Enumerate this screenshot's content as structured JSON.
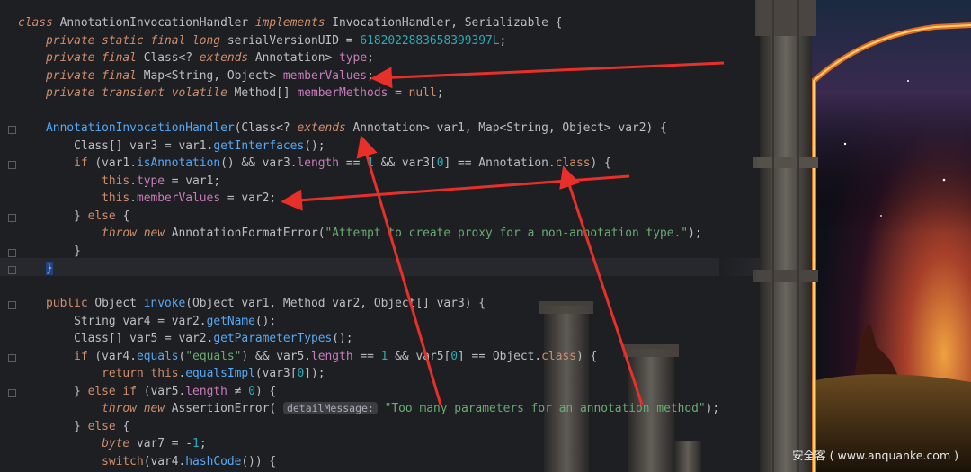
{
  "code_lines": [
    [
      [
        "kwi",
        "class "
      ],
      [
        "cls",
        "AnnotationInvocationHandler "
      ],
      [
        "kwi",
        "implements "
      ],
      [
        "cls",
        "InvocationHandler, Serializable {"
      ]
    ],
    [
      [
        "sp",
        "    "
      ],
      [
        "kwi",
        "private static final long "
      ],
      [
        "cls",
        "serialVersionUID = "
      ],
      [
        "num",
        "6182022883658399397L"
      ],
      [
        "cls",
        ";"
      ]
    ],
    [
      [
        "sp",
        "    "
      ],
      [
        "kwi",
        "private final "
      ],
      [
        "cls",
        "Class<? "
      ],
      [
        "kwi",
        "extends "
      ],
      [
        "cls",
        "Annotation> "
      ],
      [
        "fld",
        "type"
      ],
      [
        "cls",
        ";"
      ]
    ],
    [
      [
        "sp",
        "    "
      ],
      [
        "kwi",
        "private final "
      ],
      [
        "cls",
        "Map<String, Object> "
      ],
      [
        "fld",
        "memberValues"
      ],
      [
        "cls",
        ";"
      ]
    ],
    [
      [
        "sp",
        "    "
      ],
      [
        "kwi",
        "private transient volatile "
      ],
      [
        "cls",
        "Method[] "
      ],
      [
        "fld",
        "memberMethods"
      ],
      [
        "cls",
        " = "
      ],
      [
        "kw",
        "null"
      ],
      [
        "cls",
        ";"
      ]
    ],
    [],
    [
      [
        "sp",
        "    "
      ],
      [
        "fn",
        "AnnotationInvocationHandler"
      ],
      [
        "cls",
        "(Class<? "
      ],
      [
        "kwi",
        "extends "
      ],
      [
        "cls",
        "Annotation> var1, Map<String, Object> var2) {"
      ]
    ],
    [
      [
        "sp",
        "        "
      ],
      [
        "cls",
        "Class[] var3 = var1."
      ],
      [
        "fn",
        "getInterfaces"
      ],
      [
        "cls",
        "();"
      ]
    ],
    [
      [
        "sp",
        "        "
      ],
      [
        "kw",
        "if "
      ],
      [
        "cls",
        "(var1."
      ],
      [
        "fn",
        "isAnnotation"
      ],
      [
        "cls",
        "() && var3."
      ],
      [
        "fld",
        "length"
      ],
      [
        "cls",
        " == "
      ],
      [
        "num",
        "1"
      ],
      [
        "cls",
        " && var3["
      ],
      [
        "num",
        "0"
      ],
      [
        "cls",
        "] == Annotation."
      ],
      [
        "kw",
        "class"
      ],
      [
        "cls",
        ") {"
      ]
    ],
    [
      [
        "sp",
        "            "
      ],
      [
        "kw",
        "this"
      ],
      [
        "cls",
        "."
      ],
      [
        "fld",
        "type"
      ],
      [
        "cls",
        " = var1;"
      ]
    ],
    [
      [
        "sp",
        "            "
      ],
      [
        "kw",
        "this"
      ],
      [
        "cls",
        "."
      ],
      [
        "fld",
        "memberValues"
      ],
      [
        "cls",
        " = var2;"
      ]
    ],
    [
      [
        "sp",
        "        "
      ],
      [
        "cls",
        "} "
      ],
      [
        "kw",
        "else "
      ],
      [
        "cls",
        "{"
      ]
    ],
    [
      [
        "sp",
        "            "
      ],
      [
        "kwi",
        "throw new "
      ],
      [
        "cls",
        "AnnotationFormatError("
      ],
      [
        "str",
        "\"Attempt to create proxy for a non-annotation type.\""
      ],
      [
        "cls",
        ");"
      ]
    ],
    [
      [
        "sp",
        "        "
      ],
      [
        "cls",
        "}"
      ]
    ],
    [
      [
        "sp",
        "    "
      ],
      [
        "cur",
        "}"
      ]
    ],
    [],
    [
      [
        "sp",
        "    "
      ],
      [
        "kw",
        "public "
      ],
      [
        "cls",
        "Object "
      ],
      [
        "fn",
        "invoke"
      ],
      [
        "cls",
        "(Object var1, Method var2, Object[] var3) {"
      ]
    ],
    [
      [
        "sp",
        "        "
      ],
      [
        "cls",
        "String var4 = var2."
      ],
      [
        "fn",
        "getName"
      ],
      [
        "cls",
        "();"
      ]
    ],
    [
      [
        "sp",
        "        "
      ],
      [
        "cls",
        "Class[] var5 = var2."
      ],
      [
        "fn",
        "getParameterTypes"
      ],
      [
        "cls",
        "();"
      ]
    ],
    [
      [
        "sp",
        "        "
      ],
      [
        "kw",
        "if "
      ],
      [
        "cls",
        "(var4."
      ],
      [
        "fn",
        "equals"
      ],
      [
        "cls",
        "("
      ],
      [
        "str",
        "\"equals\""
      ],
      [
        "cls",
        ") && var5."
      ],
      [
        "fld",
        "length"
      ],
      [
        "cls",
        " == "
      ],
      [
        "num",
        "1"
      ],
      [
        "cls",
        " && var5["
      ],
      [
        "num",
        "0"
      ],
      [
        "cls",
        "] == Object."
      ],
      [
        "kw",
        "class"
      ],
      [
        "cls",
        ") {"
      ]
    ],
    [
      [
        "sp",
        "            "
      ],
      [
        "kw",
        "return this"
      ],
      [
        "cls",
        "."
      ],
      [
        "fn",
        "equalsImpl"
      ],
      [
        "cls",
        "(var3["
      ],
      [
        "num",
        "0"
      ],
      [
        "cls",
        "]);"
      ]
    ],
    [
      [
        "sp",
        "        "
      ],
      [
        "cls",
        "} "
      ],
      [
        "kw",
        "else if "
      ],
      [
        "cls",
        "(var5."
      ],
      [
        "fld",
        "length"
      ],
      [
        "cls",
        " ≠ "
      ],
      [
        "num",
        "0"
      ],
      [
        "cls",
        ") {"
      ]
    ],
    [
      [
        "sp",
        "            "
      ],
      [
        "kwi",
        "throw new "
      ],
      [
        "cls",
        "AssertionError( "
      ],
      [
        "hint",
        "detailMessage:"
      ],
      [
        "str",
        " \"Too many parameters for an annotation method\""
      ],
      [
        "cls",
        ");"
      ]
    ],
    [
      [
        "sp",
        "        "
      ],
      [
        "cls",
        "} "
      ],
      [
        "kw",
        "else "
      ],
      [
        "cls",
        "{"
      ]
    ],
    [
      [
        "sp",
        "            "
      ],
      [
        "kwi",
        "byte "
      ],
      [
        "cls",
        "var7 = -"
      ],
      [
        "num",
        "1"
      ],
      [
        "cls",
        ";"
      ]
    ],
    [
      [
        "sp",
        "            "
      ],
      [
        "kw",
        "switch"
      ],
      [
        "cls",
        "(var4."
      ],
      [
        "fn",
        "hashCode"
      ],
      [
        "cls",
        "()) {"
      ]
    ]
  ],
  "watermark": "安全客 ( www.anquanke.com )",
  "colors": {
    "editor_bg": "#1e1f22",
    "arrow": "#e8302a",
    "keyword": "#cf8e6d",
    "field": "#c77dbb",
    "method": "#56a8f5",
    "string": "#6aab73",
    "number": "#2aacb8"
  }
}
